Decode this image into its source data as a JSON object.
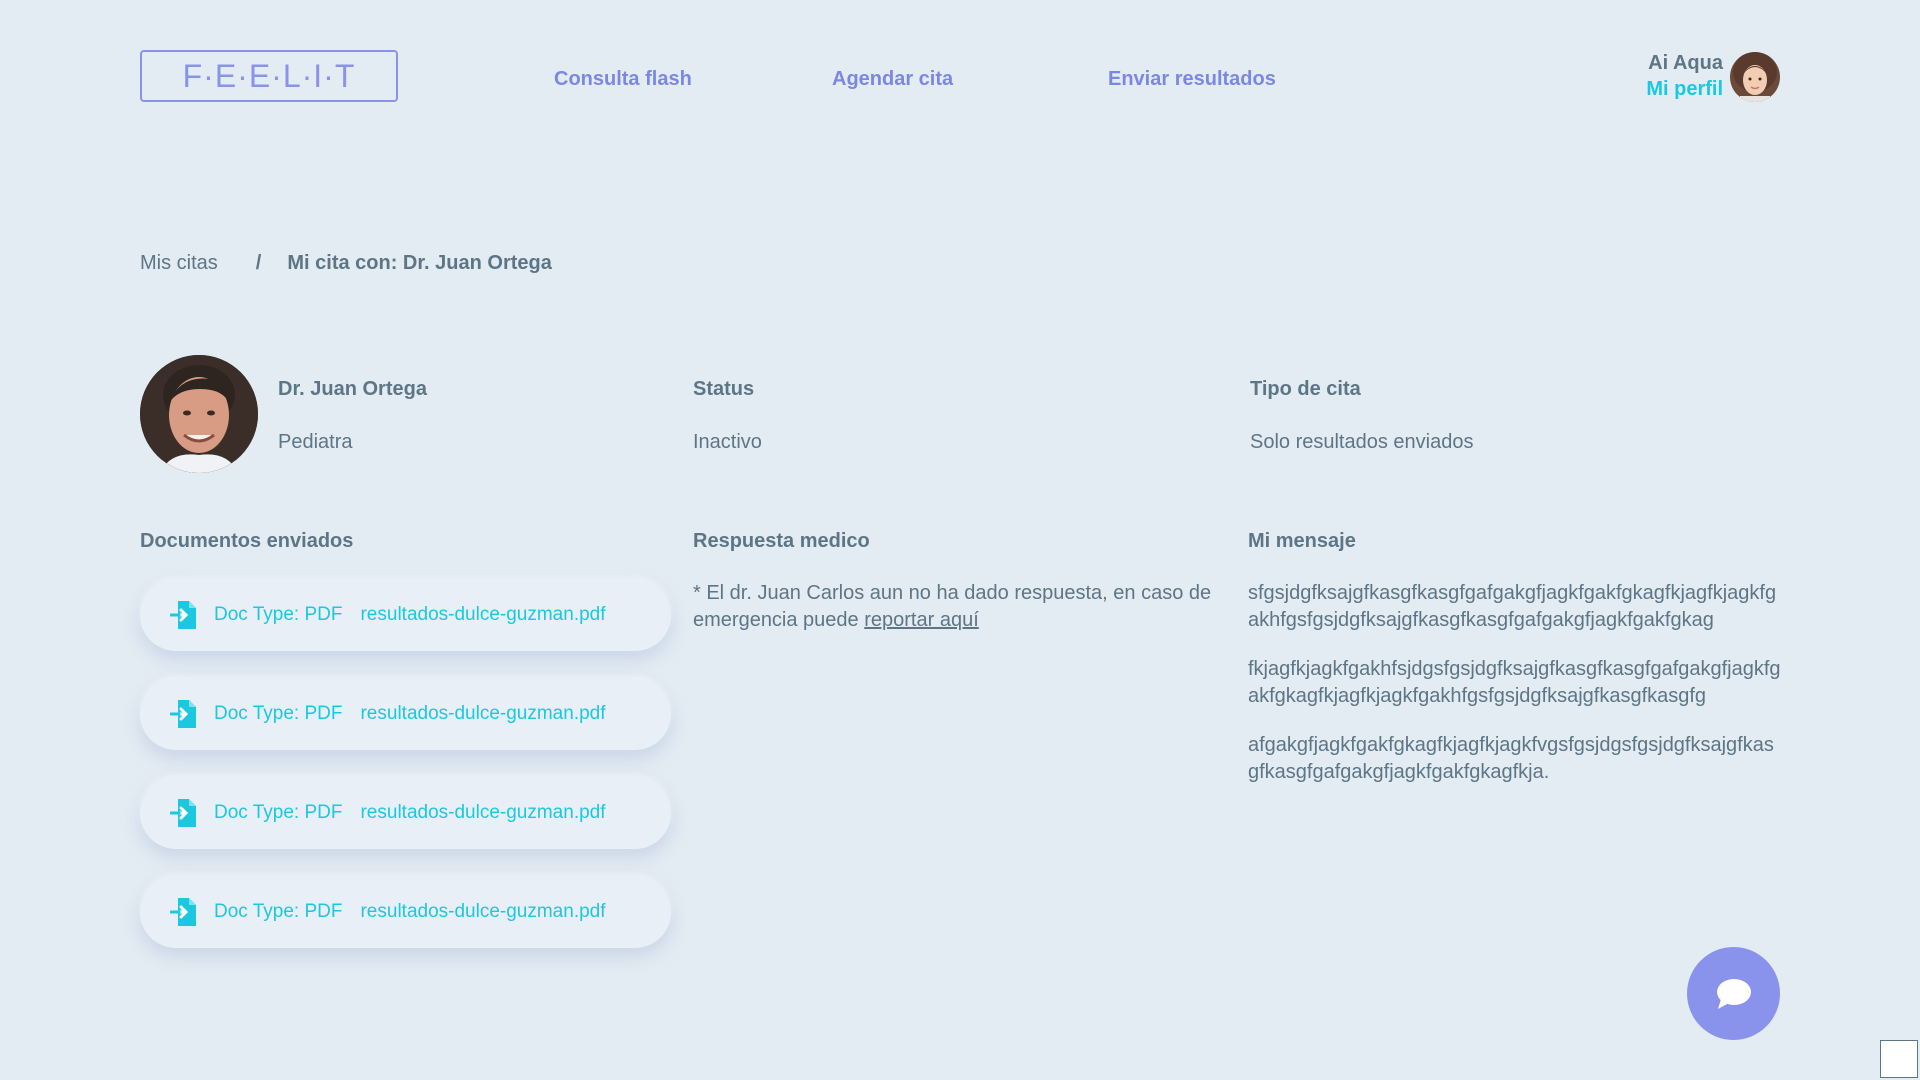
{
  "header": {
    "logo": "F·E·E·L·I·T",
    "nav": [
      "Consulta flash",
      "Agendar cita",
      "Enviar resultados"
    ],
    "user": {
      "name": "Ai Aqua",
      "profile_link": "Mi perfil"
    }
  },
  "breadcrumb": {
    "parent": "Mis citas",
    "separator": "/",
    "current": "Mi cita con: Dr. Juan Ortega"
  },
  "doctor": {
    "name": "Dr. Juan Ortega",
    "specialty": "Pediatra"
  },
  "status": {
    "label": "Status",
    "value": "Inactivo"
  },
  "appointment_type": {
    "label": "Tipo de cita",
    "value": "Solo resultados enviados"
  },
  "documents": {
    "title": "Documentos enviados",
    "items": [
      {
        "type": "Doc Type: PDF",
        "file": "resultados-dulce-guzman.pdf"
      },
      {
        "type": "Doc Type: PDF",
        "file": "resultados-dulce-guzman.pdf"
      },
      {
        "type": "Doc Type: PDF",
        "file": "resultados-dulce-guzman.pdf"
      },
      {
        "type": "Doc Type: PDF",
        "file": "resultados-dulce-guzman.pdf"
      }
    ]
  },
  "response": {
    "title": "Respuesta medico",
    "text": "* El dr. Juan Carlos aun no ha dado respuesta, en caso de emergencia puede ",
    "link": "reportar aquí"
  },
  "message": {
    "title": "Mi mensaje",
    "paragraphs": [
      "sfgsjdgfksajgfkasgfkasgfgafgakgfjagkfgakfgkagfkjagfkjagkfgakhfgsfgsjdgfksajgfkasgfkasgfgafgakgfjagkfgakfgkag",
      "fkjagfkjagkfgakhfsjdgsfgsjdgfksajgfkasgfkasgfgafgakgfjagkfgakfgkagfkjagfkjagkfgakhfgsfgsjdgfksajgfkasgfkasgfg",
      "afgakgfjagkfgakfgkagfkjagfkjagkfvgsfgsjdgsfgsjdgfksajgfkasgfkasgfgafgakgfjagkfgakfgkagfkja."
    ]
  },
  "colors": {
    "background": "#e3ecf3",
    "accent": "#8a93ec",
    "link": "#1cc8e0",
    "text": "#5e7585"
  },
  "icons": {
    "doc": "file-import-icon",
    "chat": "chat-bubble-icon"
  }
}
